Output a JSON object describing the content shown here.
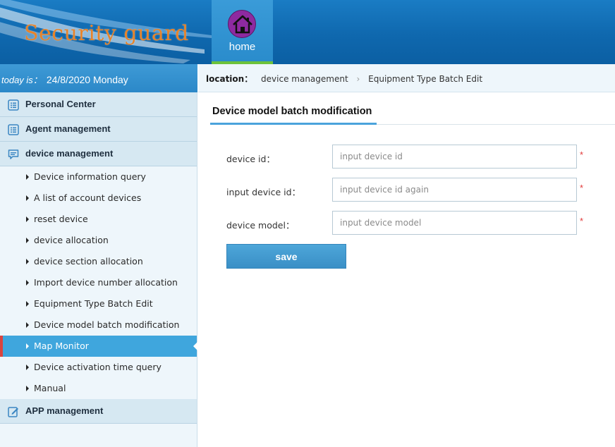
{
  "header": {
    "brand": "Security guard",
    "nav": {
      "home_label": "home",
      "home_icon": "home-icon"
    }
  },
  "datebar": {
    "prefix": "today is：",
    "date": "24/8/2020 Monday"
  },
  "location": {
    "label": "location：",
    "crumbs": [
      "device management",
      "Equipment Type Batch Edit"
    ]
  },
  "sidebar": {
    "sections": [
      {
        "label": "Personal Center",
        "icon": "list-icon"
      },
      {
        "label": "Agent management",
        "icon": "list-icon"
      },
      {
        "label": "device management",
        "icon": "chat-icon"
      },
      {
        "label": "APP management",
        "icon": "edit-icon"
      }
    ],
    "items": [
      "Device information query",
      "A list of account devices",
      "reset device",
      "device allocation",
      "device section allocation",
      "Import device number allocation",
      "Equipment Type Batch Edit",
      "Device model batch modification",
      "Map Monitor",
      "Device activation time query",
      "Manual"
    ],
    "active_item": "Map Monitor"
  },
  "content": {
    "title": "Device model batch modification",
    "fields": [
      {
        "label": "device id：",
        "placeholder": "input device id",
        "value": ""
      },
      {
        "label": "input device id：",
        "placeholder": "input device id again",
        "value": ""
      },
      {
        "label": "device model：",
        "placeholder": "input device model",
        "value": ""
      }
    ],
    "required_mark": "*",
    "save_label": "save"
  },
  "colors": {
    "header_blue": "#0f68ae",
    "brand_orange": "#e8842a",
    "active_blue": "#3fa6dd",
    "active_marker": "#d9443f",
    "home_icon_bg": "#8e2aa0",
    "required_red": "#e23b3b"
  }
}
